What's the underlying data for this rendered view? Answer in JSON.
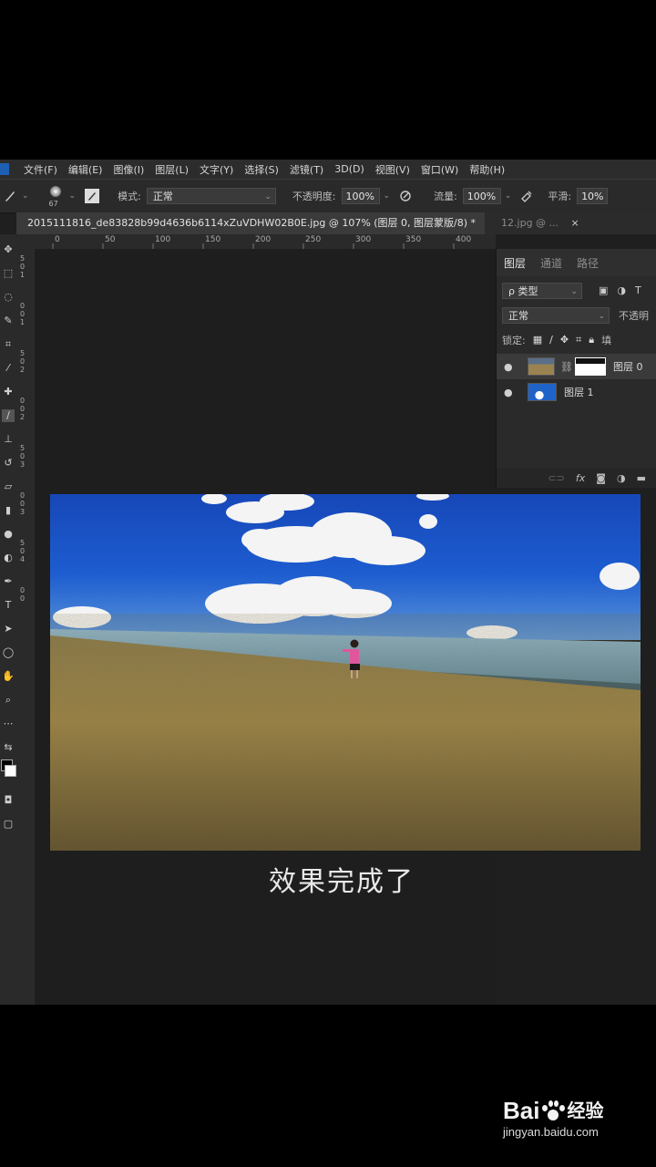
{
  "menu": [
    "文件(F)",
    "编辑(E)",
    "图像(I)",
    "图层(L)",
    "文字(Y)",
    "选择(S)",
    "滤镜(T)",
    "3D(D)",
    "视图(V)",
    "窗口(W)",
    "帮助(H)"
  ],
  "options": {
    "brush_size": "67",
    "mode_label": "模式:",
    "mode_value": "正常",
    "opacity_label": "不透明度:",
    "opacity_value": "100%",
    "flow_label": "流量:",
    "flow_value": "100%",
    "smoothing_label": "平滑:",
    "smoothing_value": "10%"
  },
  "tabs": {
    "active": "2015111816_de83828b99d4636b6114xZuVDHW02B0E.jpg @ 107% (图层 0, 图层蒙版/8) *",
    "inactive": "12.jpg @ ...",
    "close": "×"
  },
  "ruler_top_labels": [
    "0",
    "50",
    "100",
    "150",
    "200",
    "250",
    "300",
    "350",
    "400"
  ],
  "ruler_left_labels": [
    "5",
    "0",
    "1",
    "0",
    "0",
    "1",
    "5",
    "0",
    "2",
    "0",
    "0",
    "2",
    "5",
    "0",
    "3",
    "0",
    "0",
    "3",
    "5",
    "0",
    "4",
    "0",
    "0"
  ],
  "layers_panel": {
    "tabs": [
      "图层",
      "通道",
      "路径"
    ],
    "filter_label": "ρ 类型",
    "blend_mode": "正常",
    "opacity_label": "不透明",
    "lock_label": "锁定:",
    "fill_label": "填",
    "layers": [
      {
        "name": "图层 0",
        "has_mask": true
      },
      {
        "name": "图层 1",
        "has_mask": false
      }
    ],
    "footer_icons": [
      "link-icon",
      "fx-icon",
      "mask-icon",
      "adjustment-icon",
      "folder-icon"
    ]
  },
  "caption": "效果完成了",
  "watermark": {
    "brand": "Bai",
    "brand_cn": "经验",
    "url": "jingyan.baidu.com"
  }
}
